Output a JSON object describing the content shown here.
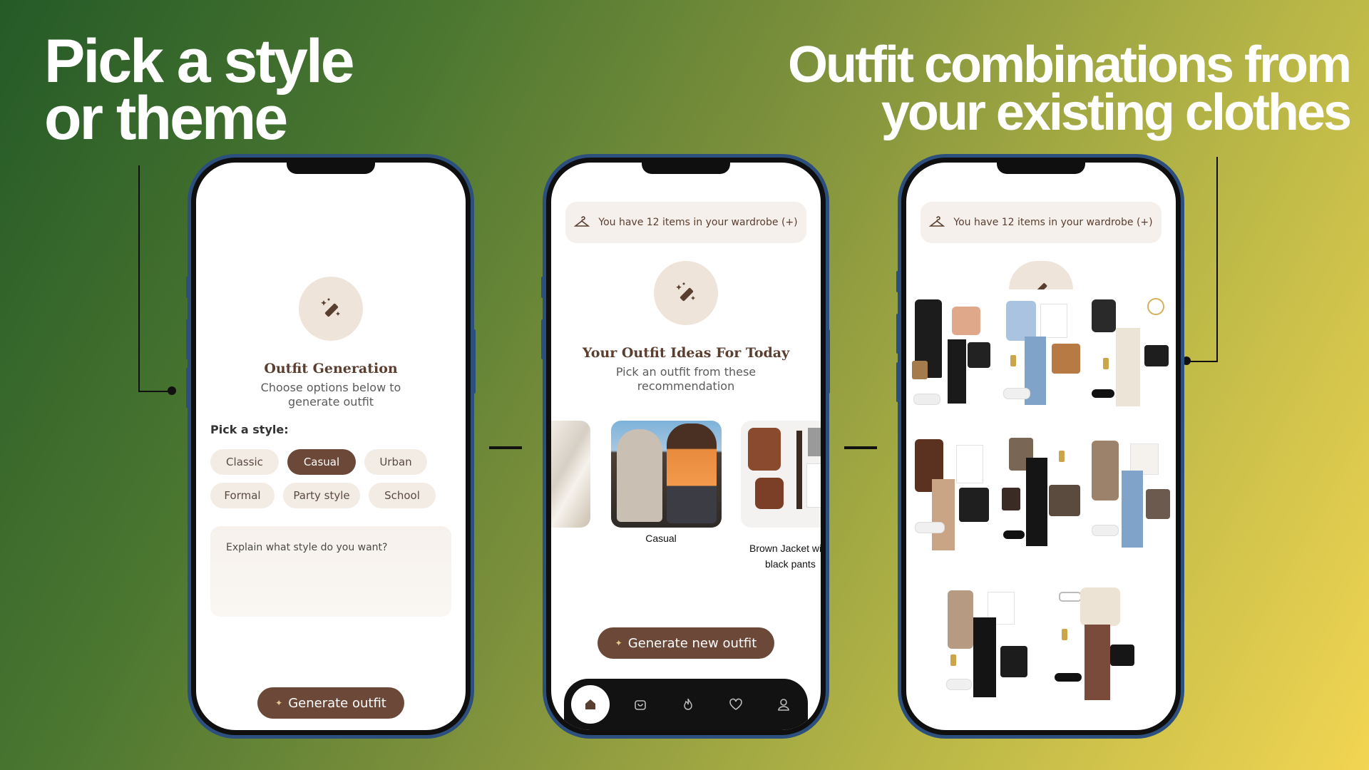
{
  "headline_left": [
    "Pick a style",
    "or theme"
  ],
  "headline_right": [
    "Outfit combinations from",
    "your existing clothes"
  ],
  "screen1": {
    "title": "Outfit Generation",
    "subtitle": [
      "Choose options below to",
      "generate outfit"
    ],
    "pick_label": "Pick a style:",
    "styles": [
      "Classic",
      "Casual",
      "Urban",
      "Formal",
      "Party style",
      "School"
    ],
    "selected_style": "Casual",
    "explain_placeholder": "Explain what style do you want?",
    "generate_label": "Generate outfit"
  },
  "screen2": {
    "wardrobe_text": "You have 12 items in your wardrobe (+)",
    "title": "Your Outfit Ideas For Today",
    "subtitle": [
      "Pick an outfit from these",
      "recommendation"
    ],
    "cards": [
      "Casual",
      "Brown Jacket wi",
      "black pants"
    ],
    "generate_label": "Generate new outfit",
    "tabs": [
      "home-icon",
      "bag-icon",
      "flame-icon",
      "heart-icon",
      "user-icon"
    ]
  },
  "screen3": {
    "wardrobe_text": "You have 12 items in your wardrobe (+)"
  },
  "colors": {
    "brand_brown": "#6b4838",
    "chip_bg": "#f2ece5",
    "phone_frame": "#2d4f7e"
  }
}
